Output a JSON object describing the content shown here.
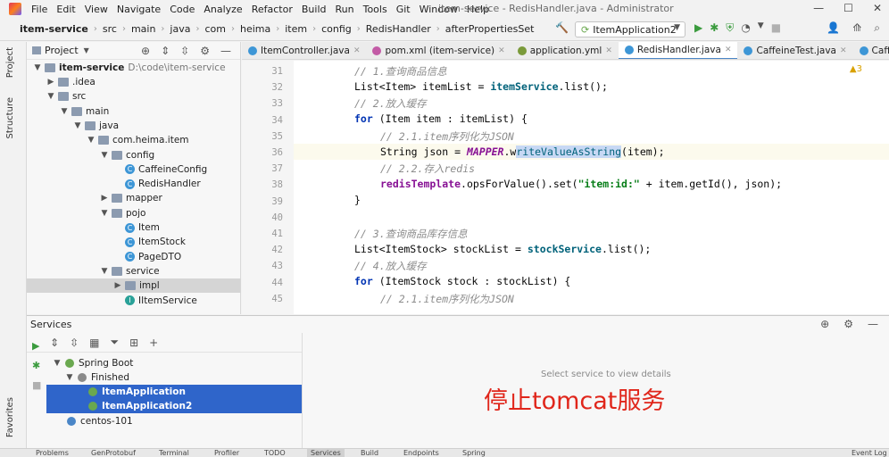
{
  "window": {
    "title": "item-service - RedisHandler.java - Administrator"
  },
  "menu": [
    "File",
    "Edit",
    "View",
    "Navigate",
    "Code",
    "Analyze",
    "Refactor",
    "Build",
    "Run",
    "Tools",
    "Git",
    "Window",
    "Help"
  ],
  "breadcrumb": [
    "item-service",
    "src",
    "main",
    "java",
    "com",
    "heima",
    "item",
    "config",
    "RedisHandler",
    "afterPropertiesSet"
  ],
  "run_config": "ItemApplication2",
  "project_panel": {
    "title": "Project",
    "root_label": "item-service",
    "root_path": "D:\\code\\item-service",
    "items": [
      {
        "label": ".idea",
        "depth": 1,
        "kind": "folder",
        "arrow": "right"
      },
      {
        "label": "src",
        "depth": 1,
        "kind": "folder",
        "arrow": "down"
      },
      {
        "label": "main",
        "depth": 2,
        "kind": "folder",
        "arrow": "down"
      },
      {
        "label": "java",
        "depth": 3,
        "kind": "folder",
        "arrow": "down"
      },
      {
        "label": "com.heima.item",
        "depth": 4,
        "kind": "folder",
        "arrow": "down"
      },
      {
        "label": "config",
        "depth": 5,
        "kind": "folder",
        "arrow": "down"
      },
      {
        "label": "CaffeineConfig",
        "depth": 6,
        "kind": "class",
        "arrow": ""
      },
      {
        "label": "RedisHandler",
        "depth": 6,
        "kind": "class",
        "arrow": ""
      },
      {
        "label": "mapper",
        "depth": 5,
        "kind": "folder",
        "arrow": "right"
      },
      {
        "label": "pojo",
        "depth": 5,
        "kind": "folder",
        "arrow": "down"
      },
      {
        "label": "Item",
        "depth": 6,
        "kind": "class",
        "arrow": ""
      },
      {
        "label": "ItemStock",
        "depth": 6,
        "kind": "class",
        "arrow": ""
      },
      {
        "label": "PageDTO",
        "depth": 6,
        "kind": "class",
        "arrow": ""
      },
      {
        "label": "service",
        "depth": 5,
        "kind": "folder",
        "arrow": "down"
      },
      {
        "label": "impl",
        "depth": 6,
        "kind": "folder",
        "arrow": "right",
        "selected": true
      },
      {
        "label": "IItemService",
        "depth": 6,
        "kind": "interface",
        "arrow": ""
      }
    ]
  },
  "editor_tabs": [
    {
      "label": "ItemController.java",
      "color": "#3d96d6"
    },
    {
      "label": "pom.xml (item-service)",
      "color": "#c35ba6"
    },
    {
      "label": "application.yml",
      "color": "#7a9a3a"
    },
    {
      "label": "RedisHandler.java",
      "color": "#3d96d6",
      "active": true
    },
    {
      "label": "CaffeineTest.java",
      "color": "#3d96d6"
    },
    {
      "label": "CaffeineConfig.java",
      "color": "#3d96d6"
    }
  ],
  "editor": {
    "warning_count": "3",
    "line_numbers": [
      "31",
      "32",
      "33",
      "34",
      "35",
      "36",
      "37",
      "38",
      "39",
      "40",
      "41",
      "42",
      "43",
      "44",
      "45"
    ],
    "lines": {
      "l31": "// 1.查询商品信息",
      "l32a": "List<Item> itemList = ",
      "l32b": "itemService",
      "l32c": ".list();",
      "l33": "// 2.放入缓存",
      "l34a": "for",
      "l34b": " (Item item : itemList) {",
      "l35": "// 2.1.item序列化为JSON",
      "l36a": "String json = ",
      "l36b": "MAPPER",
      "l36c": ".w",
      "l36d": "riteValueAsString",
      "l36e": "(item);",
      "l37": "// 2.2.存入redis",
      "l38a": "redisTemplate",
      "l38b": ".opsForValue().set(",
      "l38c": "\"item:id:\"",
      "l38d": " + item.getId(), json);",
      "l39": "}",
      "l41": "// 3.查询商品库存信息",
      "l42a": "List<ItemStock> stockList = ",
      "l42b": "stockService",
      "l42c": ".list();",
      "l43": "// 4.放入缓存",
      "l44a": "for",
      "l44b": " (ItemStock stock : stockList) {",
      "l45": "// 2.1.item序列化为JSON"
    }
  },
  "services_panel": {
    "title": "Services",
    "tree": {
      "spring_boot": "Spring Boot",
      "finished": "Finished",
      "app1": "ItemApplication",
      "app2": "ItemApplication2",
      "centos": "centos-101"
    },
    "placeholder": "Select service to view details",
    "overlay": "停止tomcat服务"
  },
  "side_tabs": {
    "project": "Project",
    "structure": "Structure",
    "favorites": "Favorites"
  },
  "bottom_tabs": [
    "Problems",
    "GenProtobuf",
    "Terminal",
    "Profiler",
    "TODO",
    "Services",
    "Build",
    "Endpoints",
    "Spring",
    "Event Log"
  ]
}
